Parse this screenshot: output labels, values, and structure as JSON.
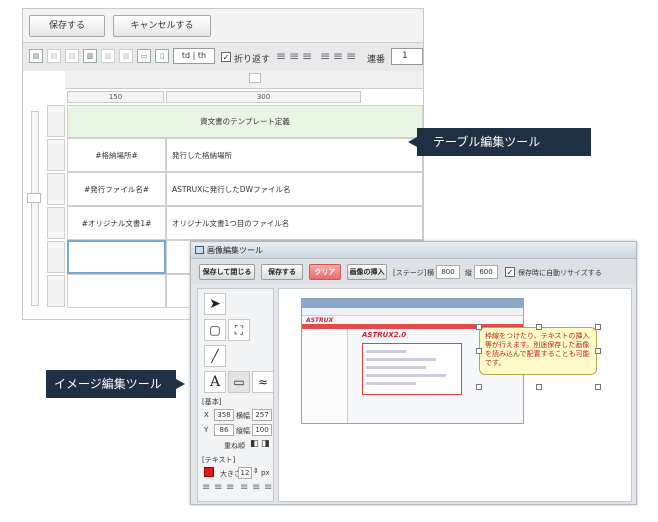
{
  "table_editor": {
    "buttons": {
      "save": "保存する",
      "cancel": "キャンセルする"
    },
    "toolbar": {
      "tdth": "td | th",
      "wrap_label": "折り返す",
      "wrap_checked": "✓",
      "serial_label": "連番",
      "serial_value": "1"
    },
    "column_widths": [
      "150",
      "300"
    ],
    "rows": [
      {
        "col1": "資文書のテンプレート定義",
        "col2": ""
      },
      {
        "col1": "#格納場所#",
        "col2": "発行した格納場所"
      },
      {
        "col1": "#発行ファイル名#",
        "col2": "ASTRUXに発行したDWファイル名"
      },
      {
        "col1": "#オリジナル文書1#",
        "col2": "オリジナル文書1つ目のファイル名"
      },
      {
        "col1": "",
        "col2": ""
      },
      {
        "col1": "",
        "col2": ""
      }
    ]
  },
  "image_editor": {
    "title": "画像編集ツール",
    "buttons": {
      "save_close": "保存して閉じる",
      "save": "保存する",
      "clear": "クリア",
      "insert_image": "画像の挿入"
    },
    "stage_label": "[ステージ]",
    "width_label": "横",
    "width_value": "800",
    "height_label": "縦",
    "height_value": "600",
    "auto_resize_label": "保存時に自動リサイズする",
    "auto_resize_checked": "✓",
    "basic_section": "[基本]",
    "x_label": "X",
    "x_value": "358",
    "w_label": "横幅",
    "w_value": "257",
    "y_label": "Y",
    "y_value": "86",
    "h_label": "縦幅",
    "h_value": "100",
    "order_label": "重ね順",
    "text_section": "[テキスト]",
    "size_label": "大きさ",
    "size_value": "12",
    "size_unit": "px",
    "text_color": "#e01818",
    "canvas": {
      "shot_logo": "ASTRUX",
      "shot_title": "ASTRUX2.0",
      "callout_text": "枠線をつけたり、テキストの挿入等が行えます。別途保存した画像を読み込んで配置することも可能です。"
    }
  },
  "labels": {
    "table_tool": "テーブル編集ツール",
    "image_tool": "イメージ編集ツール"
  },
  "colors": {
    "label_bg": "#1f2f44",
    "header_row": "#e8f5e3",
    "selected_cell_border": "#79a9cf",
    "callout_bg": "#fffcc8"
  }
}
